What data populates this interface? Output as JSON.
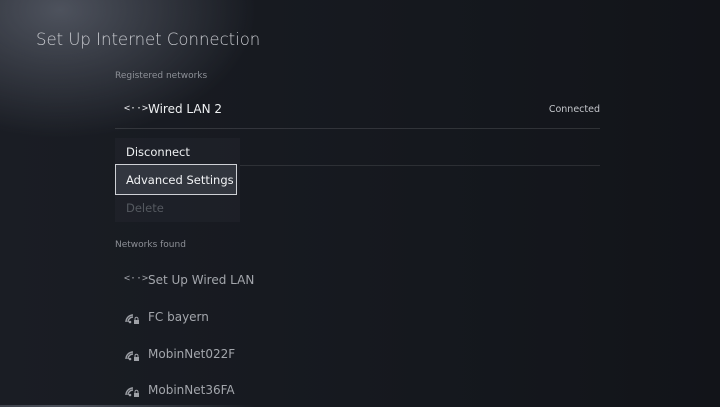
{
  "header": {
    "title": "Set Up Internet Connection"
  },
  "registered": {
    "label": "Registered networks",
    "network": {
      "icon": "wired-lan-icon",
      "icon_glyph": "<··>",
      "name": "Wired LAN 2",
      "status": "Connected"
    }
  },
  "menu": {
    "items": [
      {
        "label": "Disconnect",
        "state": "enabled"
      },
      {
        "label": "Advanced Settings",
        "state": "focused"
      },
      {
        "label": "Delete",
        "state": "disabled"
      }
    ]
  },
  "found": {
    "label": "Networks found",
    "networks": [
      {
        "icon": "wired-lan-icon",
        "icon_glyph": "<··>",
        "name": "Set Up Wired LAN"
      },
      {
        "icon": "wifi-locked-icon",
        "name": "FC bayern"
      },
      {
        "icon": "wifi-locked-icon",
        "name": "MobinNet022F"
      },
      {
        "icon": "wifi-locked-icon",
        "name": "MobinNet36FA"
      }
    ]
  },
  "colors": {
    "focus_border": "#cfd1d6",
    "text_primary": "#eef0f2",
    "text_secondary": "#a3a6ac",
    "text_disabled": "#555960"
  }
}
